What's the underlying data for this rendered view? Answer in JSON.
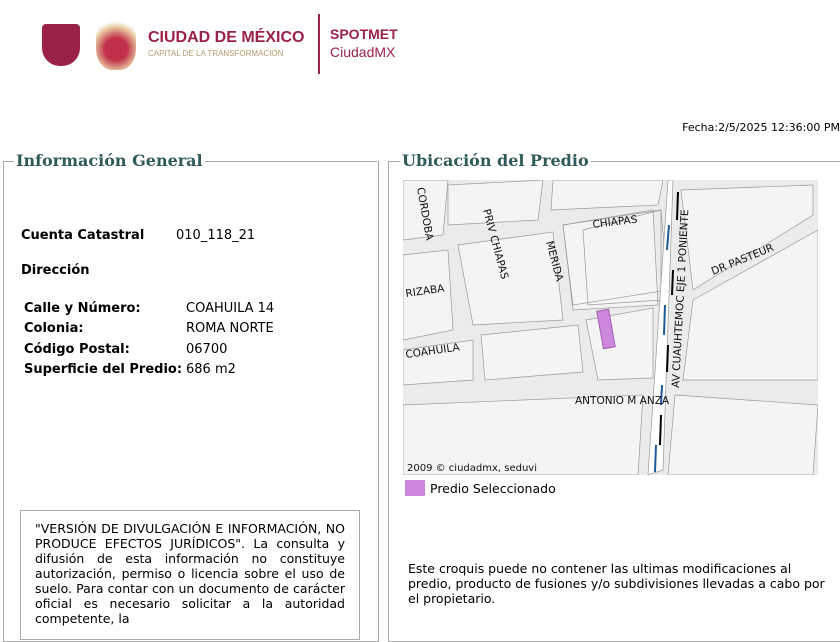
{
  "header": {
    "logo_title": "CIUDAD DE MÉXICO",
    "logo_subtitle": "CAPITAL DE LA TRANSFORMACIÓN",
    "app_name": "SPOTMET",
    "app_sub": "CiudadMX",
    "fecha": "Fecha:2/5/2025 12:36:00 PM"
  },
  "general": {
    "title": "Información General",
    "cuenta_label": "Cuenta Catastral",
    "cuenta_value": "010_118_21",
    "direccion_label": "Dirección",
    "fields": [
      {
        "label": "Calle y Número:",
        "value": "COAHUILA 14"
      },
      {
        "label": "Colonia:",
        "value": "ROMA NORTE"
      },
      {
        "label": "Código Postal:",
        "value": "06700"
      },
      {
        "label": "Superficie del Predio:",
        "value": "686 m2"
      }
    ],
    "disclaimer": "\"VERSIÓN DE DIVULGACIÓN E INFORMACIÓN, NO PRODUCE EFECTOS JURÍDICOS\". La consulta y difusión de esta información no constituye autorización, permiso o licencia sobre el uso de suelo. Para contar con un documento de carácter oficial es necesario solicitar a la autoridad competente, la"
  },
  "ubicacion": {
    "title": "Ubicación del Predio",
    "streets": [
      "CORDOBA",
      "PRIV CHIAPAS",
      "MERIDA",
      "CHIAPAS",
      "AV CUAUHTEMOC EJE 1 PONIENTE",
      "DR PASTEUR",
      "RIZABA",
      "COAHUILA",
      "ANTONIO M ANZA"
    ],
    "copyright": "2009 © ciudadmx, seduvi",
    "legend_label": "Predio Seleccionado",
    "legend_color": "#cc88dd",
    "note": "Este croquis puede no contener las ultimas modificaciones al predio, producto de fusiones y/o subdivisiones llevadas a cabo por el propietario."
  }
}
